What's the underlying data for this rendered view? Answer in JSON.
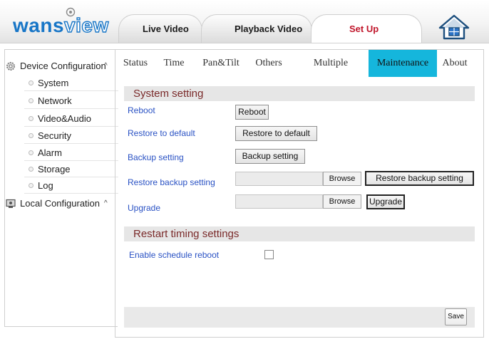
{
  "header": {
    "logo": {
      "part_a": "wans",
      "part_b": "view"
    },
    "tabs": [
      {
        "label": "Live Video"
      },
      {
        "label": "Playback Video"
      },
      {
        "label": "Set Up"
      }
    ],
    "home_icon": "home-icon",
    "accent_color": "#c0152a"
  },
  "sidebar": {
    "device_group": {
      "label": "Device Configuration",
      "icon": "gear-icon",
      "caret": "^"
    },
    "items": [
      {
        "label": "System"
      },
      {
        "label": "Network"
      },
      {
        "label": "Video&Audio"
      },
      {
        "label": "Security"
      },
      {
        "label": "Alarm"
      },
      {
        "label": "Storage"
      },
      {
        "label": "Log"
      }
    ],
    "local_group": {
      "label": "Local Configuration",
      "icon": "monitor-icon",
      "caret": "^"
    }
  },
  "main": {
    "tabs": [
      {
        "label": "Status"
      },
      {
        "label": "Time"
      },
      {
        "label": "Pan&Tilt"
      },
      {
        "label": "Others"
      },
      {
        "label": "Multiple Settings"
      },
      {
        "label": "Maintenance"
      },
      {
        "label": "About"
      }
    ],
    "active_tab_color": "#15b6dc",
    "system_setting": {
      "title": "System setting",
      "reboot": {
        "label": "Reboot",
        "button": "Reboot"
      },
      "restore_default": {
        "label": "Restore to default",
        "button": "Restore to default"
      },
      "backup": {
        "label": "Backup setting",
        "button": "Backup setting"
      },
      "restore_backup": {
        "label": "Restore backup setting",
        "browse": "Browse",
        "button": "Restore backup setting"
      },
      "upgrade": {
        "label": "Upgrade",
        "browse": "Browse",
        "button": "Upgrade"
      }
    },
    "restart_timing": {
      "title": "Restart timing settings",
      "enable_label": "Enable schedule reboot",
      "enabled": false
    },
    "save_label": "Save"
  }
}
